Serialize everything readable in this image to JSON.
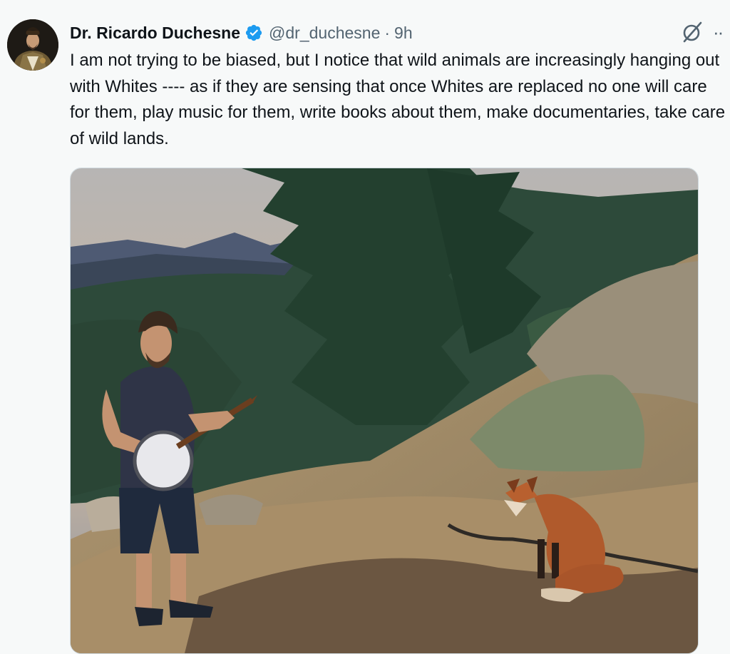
{
  "tweet": {
    "author_name": "Dr. Ricardo Duchesne",
    "handle": "@dr_duchesne",
    "separator": "·",
    "time": "9h",
    "text": "I am not trying to be biased, but I notice that wild animals are increasingly hanging out with Whites ---- as if they are sensing that once Whites are replaced no one will care for them, play music for them, write books about them, make documentaries, take care of wild lands.",
    "more_label": "··"
  },
  "colors": {
    "verified_badge": "#1d9bf0",
    "secondary_text": "#536471",
    "primary_text": "#0f1419"
  },
  "icons": {
    "verified": "verified-badge-icon",
    "grok": "grok-icon",
    "more": "more-options-icon"
  }
}
